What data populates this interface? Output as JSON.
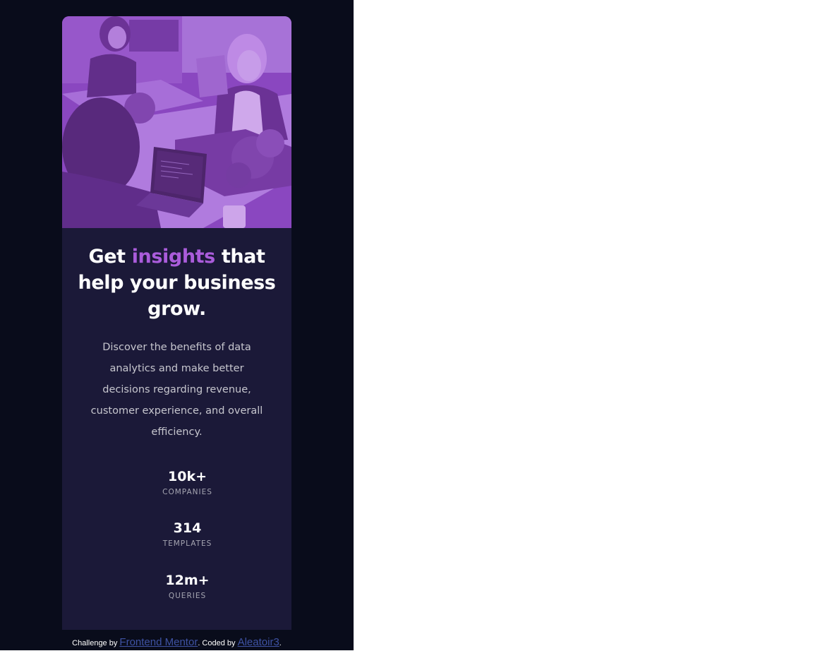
{
  "card": {
    "hero_image_icon": "office-workers-photo",
    "accent_color": "#aa5cdb",
    "card_bg_color": "#1b1938",
    "page_bg_color": "#090c1b",
    "headline": {
      "before": "Get ",
      "accent": "insights",
      "after": " that help your business grow."
    },
    "description": "Discover the benefits of data analytics and make better decisions regarding revenue, customer experience, and overall efficiency.",
    "stats": [
      {
        "value": "10k+",
        "label": "COMPANIES"
      },
      {
        "value": "314",
        "label": "TEMPLATES"
      },
      {
        "value": "12m+",
        "label": "QUERIES"
      }
    ]
  },
  "attribution": {
    "prefix": "Challenge by ",
    "link1": "Frontend Mentor",
    "middle": ". Coded by ",
    "link2": "Aleatoir3",
    "suffix": "."
  }
}
